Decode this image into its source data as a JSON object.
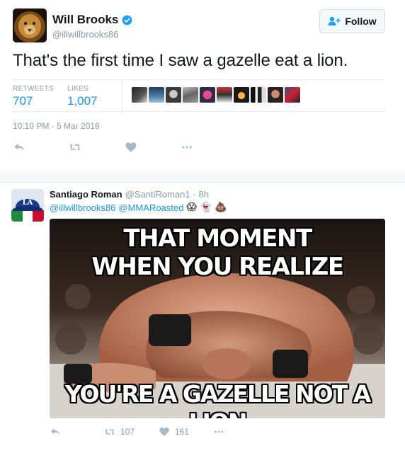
{
  "main_tweet": {
    "user": {
      "name": "Will Brooks",
      "handle": "@illwillbrooks86",
      "verified": true,
      "avatar": "lion-avatar"
    },
    "follow_label": "Follow",
    "text": "That's the first time I saw a gazelle eat a lion.",
    "stats": {
      "retweets_label": "RETWEETS",
      "retweets": "707",
      "likes_label": "LIKES",
      "likes": "1,007",
      "liker_avatar_count_shown": 10
    },
    "timestamp": "10:10 PM - 5 Mar 2016",
    "actions": [
      "reply-icon",
      "retweet-icon",
      "like-icon",
      "more-icon"
    ]
  },
  "reply_tweet": {
    "user": {
      "name": "Santiago Roman",
      "handle": "@SantiRoman1",
      "avatar": "dodgers-hat-avatar"
    },
    "time": "· 8h",
    "mentions": [
      "@illwillbrooks86",
      "@MMARoasted"
    ],
    "emojis": [
      "😱",
      "👻",
      "💩"
    ],
    "meme": {
      "top_text_line1": "THAT MOMENT",
      "top_text_line2": "WHEN YOU REALIZE",
      "bottom_text": "YOU'RE A GAZELLE NOT A LION"
    },
    "actions": {
      "retweets": "107",
      "likes": "161"
    }
  },
  "colors": {
    "link": "#1b95e0",
    "muted": "#8899a6",
    "text": "#14171a",
    "border": "#e6ecf0"
  }
}
